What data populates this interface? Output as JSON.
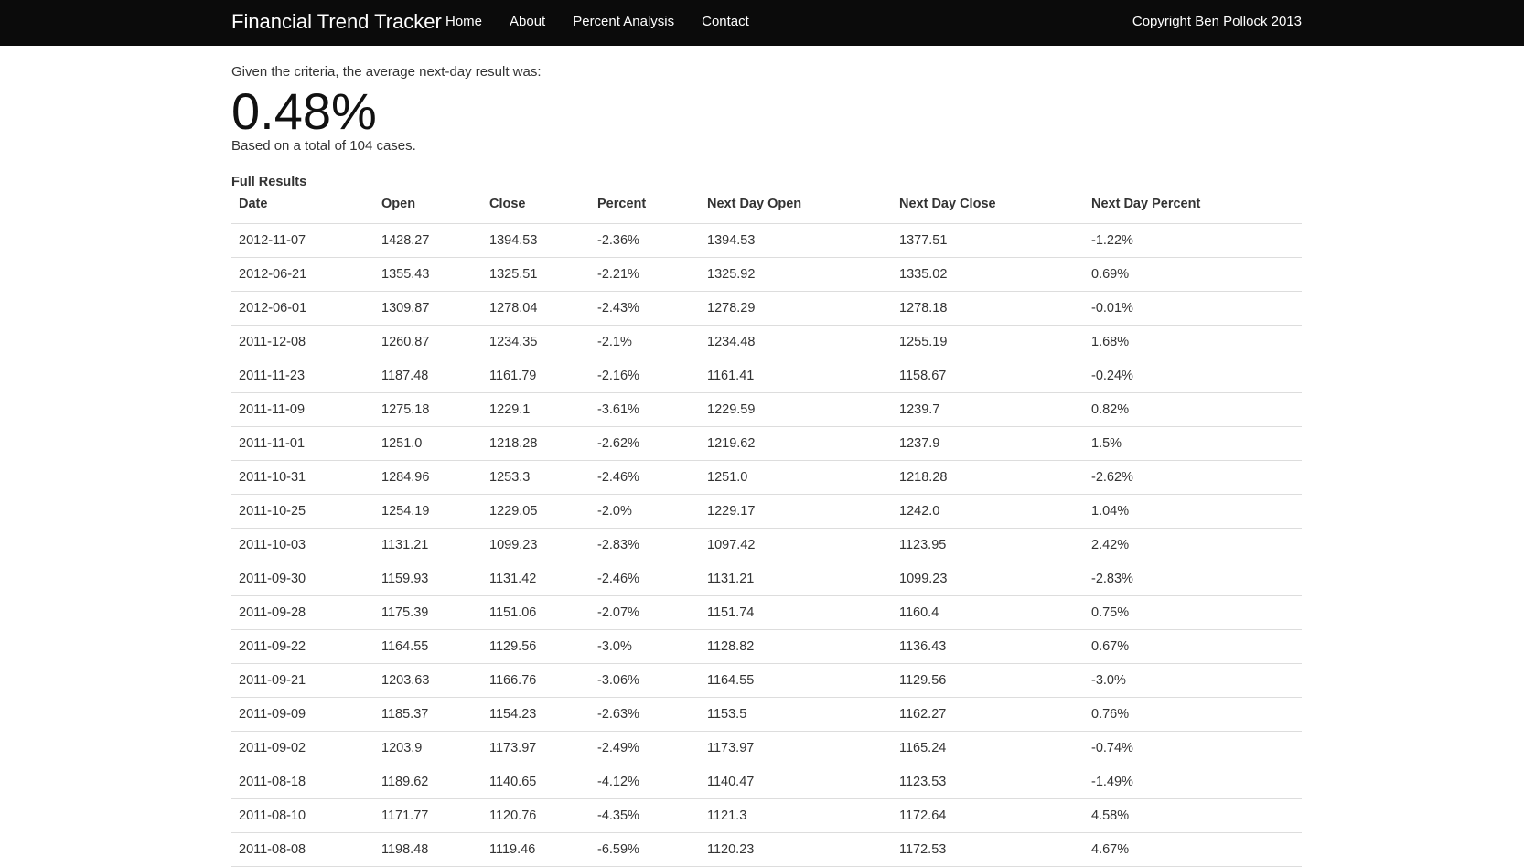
{
  "navbar": {
    "brand": "Financial Trend Tracker",
    "links": [
      "Home",
      "About",
      "Percent Analysis",
      "Contact"
    ],
    "copyright": "Copyright Ben Pollock 2013"
  },
  "summary": {
    "intro": "Given the criteria, the average next-day result was:",
    "value": "0.48%",
    "basis": "Based on a total of 104 cases."
  },
  "results": {
    "title": "Full Results",
    "columns": [
      "Date",
      "Open",
      "Close",
      "Percent",
      "Next Day Open",
      "Next Day Close",
      "Next Day Percent"
    ],
    "rows": [
      [
        "2012-11-07",
        "1428.27",
        "1394.53",
        "-2.36%",
        "1394.53",
        "1377.51",
        "-1.22%"
      ],
      [
        "2012-06-21",
        "1355.43",
        "1325.51",
        "-2.21%",
        "1325.92",
        "1335.02",
        "0.69%"
      ],
      [
        "2012-06-01",
        "1309.87",
        "1278.04",
        "-2.43%",
        "1278.29",
        "1278.18",
        "-0.01%"
      ],
      [
        "2011-12-08",
        "1260.87",
        "1234.35",
        "-2.1%",
        "1234.48",
        "1255.19",
        "1.68%"
      ],
      [
        "2011-11-23",
        "1187.48",
        "1161.79",
        "-2.16%",
        "1161.41",
        "1158.67",
        "-0.24%"
      ],
      [
        "2011-11-09",
        "1275.18",
        "1229.1",
        "-3.61%",
        "1229.59",
        "1239.7",
        "0.82%"
      ],
      [
        "2011-11-01",
        "1251.0",
        "1218.28",
        "-2.62%",
        "1219.62",
        "1237.9",
        "1.5%"
      ],
      [
        "2011-10-31",
        "1284.96",
        "1253.3",
        "-2.46%",
        "1251.0",
        "1218.28",
        "-2.62%"
      ],
      [
        "2011-10-25",
        "1254.19",
        "1229.05",
        "-2.0%",
        "1229.17",
        "1242.0",
        "1.04%"
      ],
      [
        "2011-10-03",
        "1131.21",
        "1099.23",
        "-2.83%",
        "1097.42",
        "1123.95",
        "2.42%"
      ],
      [
        "2011-09-30",
        "1159.93",
        "1131.42",
        "-2.46%",
        "1131.21",
        "1099.23",
        "-2.83%"
      ],
      [
        "2011-09-28",
        "1175.39",
        "1151.06",
        "-2.07%",
        "1151.74",
        "1160.4",
        "0.75%"
      ],
      [
        "2011-09-22",
        "1164.55",
        "1129.56",
        "-3.0%",
        "1128.82",
        "1136.43",
        "0.67%"
      ],
      [
        "2011-09-21",
        "1203.63",
        "1166.76",
        "-3.06%",
        "1164.55",
        "1129.56",
        "-3.0%"
      ],
      [
        "2011-09-09",
        "1185.37",
        "1154.23",
        "-2.63%",
        "1153.5",
        "1162.27",
        "0.76%"
      ],
      [
        "2011-09-02",
        "1203.9",
        "1173.97",
        "-2.49%",
        "1173.97",
        "1165.24",
        "-0.74%"
      ],
      [
        "2011-08-18",
        "1189.62",
        "1140.65",
        "-4.12%",
        "1140.47",
        "1123.53",
        "-1.49%"
      ],
      [
        "2011-08-10",
        "1171.77",
        "1120.76",
        "-4.35%",
        "1121.3",
        "1172.64",
        "4.58%"
      ],
      [
        "2011-08-08",
        "1198.48",
        "1119.46",
        "-6.59%",
        "1120.23",
        "1172.53",
        "4.67%"
      ]
    ]
  }
}
